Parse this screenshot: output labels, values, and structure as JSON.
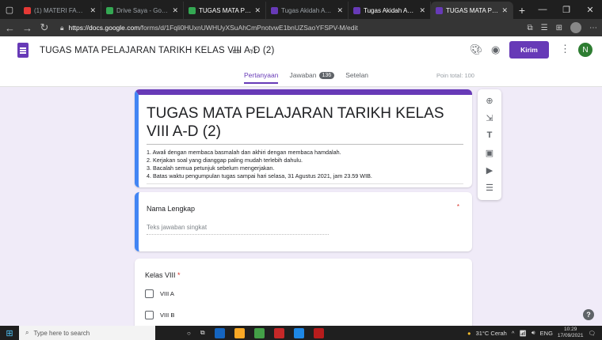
{
  "browser": {
    "tabs": [
      {
        "title": "(1) MATERI FAKTOR K",
        "color": "#e53935",
        "active": false
      },
      {
        "title": "Drive Saya - Google D",
        "color": "#34a853",
        "active": false
      },
      {
        "title": "TUGAS MATA PELAJAR",
        "color": "#34a853",
        "active": false
      },
      {
        "title": "Tugas Akidah Akhlak",
        "color": "#673ab7",
        "active": false
      },
      {
        "title": "Tugas Akidah Akhlak",
        "color": "#673ab7",
        "active": false
      },
      {
        "title": "TUGAS MATA PELAJAR",
        "color": "#673ab7",
        "active": true
      }
    ],
    "url_host": "https://docs.google.com",
    "url_path": "/forms/d/1Fqli0HUxnUWHUyXSuAhCmPnotvwE1bnUZSaoYFSPV-M/edit"
  },
  "header": {
    "doc_title": "TUGAS MATA PELAJARAN TARIKH KELAS VIII A-D (2)",
    "send_label": "Kirim",
    "avatar_initial": "N",
    "tabs": {
      "questions": "Pertanyaan",
      "responses": "Jawaban",
      "responses_count": "136",
      "settings": "Setelan"
    },
    "points": "Poin total: 100"
  },
  "form": {
    "title": "TUGAS MATA PELAJARAN TARIKH KELAS VIII A-D (2)",
    "description": [
      "1. Awali dengan membaca basmalah dan akhiri dengan membaca hamdalah.",
      "2. Kerjakan soal yang dianggap paling mudah terlebih dahulu.",
      "3. Bacalah semua petunjuk sebelum mengerjakan.",
      "4. Batas waktu pengumpulan tugas sampai hari selasa, 31 Agustus 2021, jam 23.59 WIB."
    ],
    "questions": [
      {
        "label": "Nama Lengkap",
        "required_mark": "*",
        "placeholder": "Teks jawaban singkat"
      },
      {
        "label": "Kelas VIII",
        "required_mark": "*",
        "options": [
          "VIII A",
          "VIII B"
        ]
      }
    ]
  },
  "taskbar": {
    "search_placeholder": "Type here to search",
    "weather": "31°C Cerah",
    "lang": "ENG",
    "time": "10:29",
    "date": "17/09/2021"
  }
}
